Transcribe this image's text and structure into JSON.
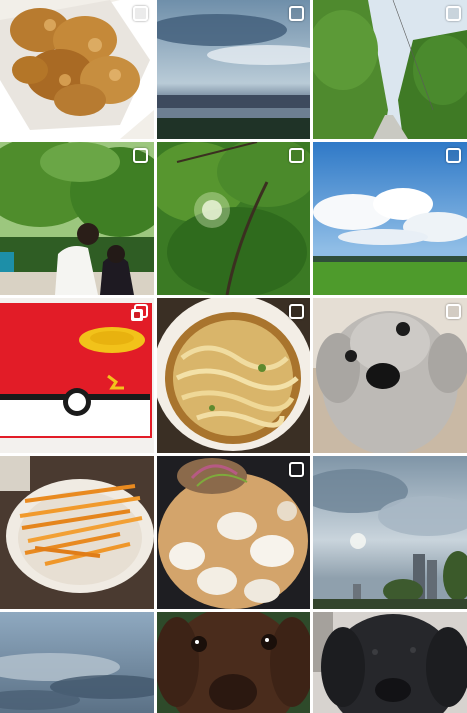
{
  "gallery": {
    "columns": 3,
    "photos": [
      {
        "subject": "fried-chicken",
        "selected": false
      },
      {
        "subject": "blue-sky-over-field",
        "selected": false
      },
      {
        "subject": "tree-lined-path",
        "selected": false
      },
      {
        "subject": "people-under-trees",
        "selected": false
      },
      {
        "subject": "sunlight-through-leaves",
        "selected": false
      },
      {
        "subject": "clouds-over-rice-field",
        "selected": false
      },
      {
        "subject": "pokeball-bank",
        "selected": false,
        "icon": "multiple-photos-icon"
      },
      {
        "subject": "noodle-bowl",
        "selected": false
      },
      {
        "subject": "gray-poodle",
        "selected": false
      },
      {
        "subject": "fries-on-plate",
        "selected": false
      },
      {
        "subject": "squid-dish",
        "selected": false
      },
      {
        "subject": "cloudy-city-sky",
        "selected": false
      },
      {
        "subject": "evening-clouds",
        "selected": false
      },
      {
        "subject": "brown-poodle-closeup",
        "selected": false
      },
      {
        "subject": "black-poodle-closeup",
        "selected": false
      }
    ]
  }
}
